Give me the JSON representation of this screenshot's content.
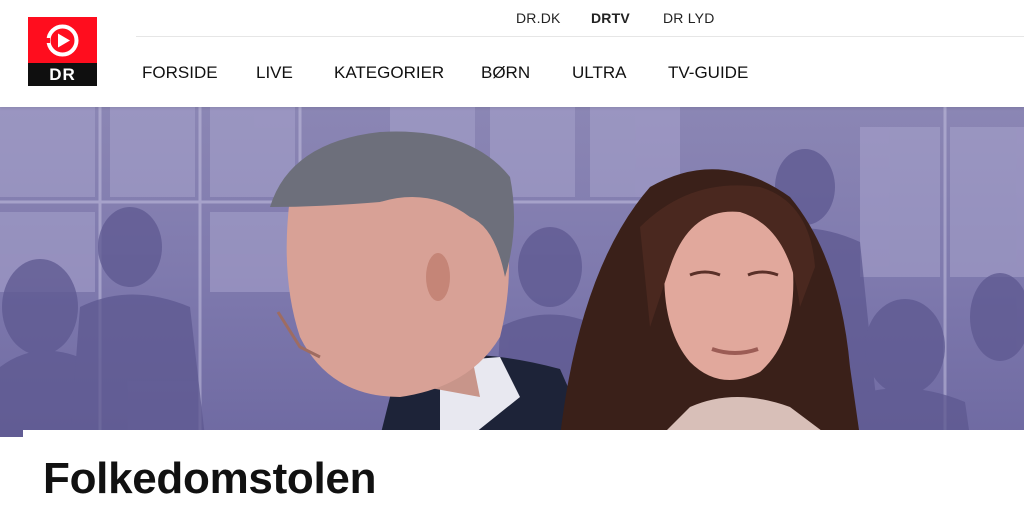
{
  "brand": {
    "logo_text": "DR",
    "accent_color": "#ff0d1e",
    "logo_icon": "play-circle-icon"
  },
  "top_links": [
    {
      "label": "DR.DK",
      "active": false
    },
    {
      "label": "DRTV",
      "active": true
    },
    {
      "label": "DR LYD",
      "active": false
    }
  ],
  "nav": {
    "items": [
      {
        "label": "FORSIDE"
      },
      {
        "label": "LIVE"
      },
      {
        "label": "KATEGORIER"
      },
      {
        "label": "BØRN"
      },
      {
        "label": "ULTRA"
      },
      {
        "label": "TV-GUIDE"
      }
    ]
  },
  "hero": {
    "image": "promo-image-two-people-in-courtroom",
    "tint_color": "#8582b2"
  },
  "program": {
    "title": "Folkedomstolen"
  }
}
